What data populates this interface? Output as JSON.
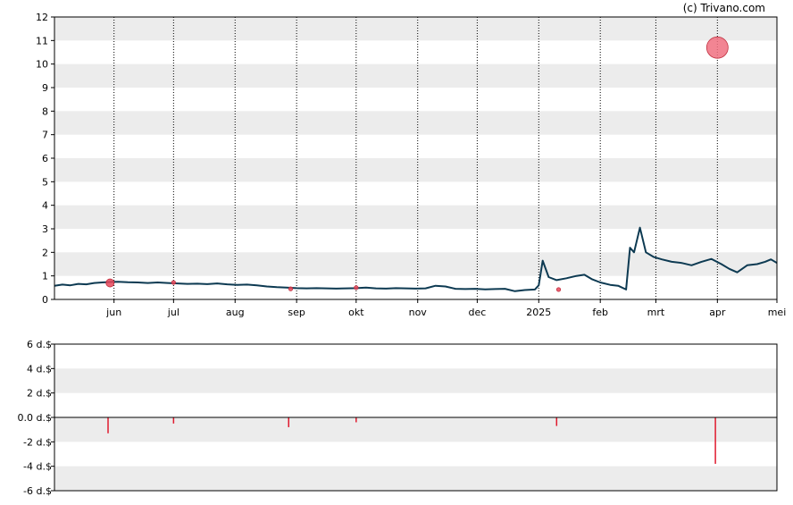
{
  "credit": "(c) Trivano.com",
  "chart_data": [
    {
      "type": "line",
      "panel": "price",
      "ylim": [
        0,
        12
      ],
      "y_ticks": [
        "0",
        "1",
        "2",
        "3",
        "4",
        "5",
        "6",
        "7",
        "8",
        "9",
        "10",
        "11",
        "12"
      ],
      "x_tick_labels": [
        {
          "label": "jun",
          "date": "2024-06-01"
        },
        {
          "label": "jul",
          "date": "2024-07-01"
        },
        {
          "label": "aug",
          "date": "2024-08-01"
        },
        {
          "label": "sep",
          "date": "2024-09-01"
        },
        {
          "label": "okt",
          "date": "2024-10-01"
        },
        {
          "label": "nov",
          "date": "2024-11-01"
        },
        {
          "label": "dec",
          "date": "2024-12-01"
        },
        {
          "label": "2025",
          "date": "2025-01-01"
        },
        {
          "label": "feb",
          "date": "2025-02-01"
        },
        {
          "label": "mrt",
          "date": "2025-03-01"
        },
        {
          "label": "apr",
          "date": "2025-04-01"
        },
        {
          "label": "mei",
          "date": "2025-05-01"
        }
      ],
      "xlim": [
        "2024-05-02",
        "2025-05-01"
      ],
      "grid": "horizontal bands, vertical dotted lines at month starts",
      "series": [
        {
          "color": "#0d3a52",
          "points": [
            [
              "2024-05-02",
              0.58
            ],
            [
              "2024-05-06",
              0.63
            ],
            [
              "2024-05-10",
              0.6
            ],
            [
              "2024-05-14",
              0.66
            ],
            [
              "2024-05-18",
              0.64
            ],
            [
              "2024-05-22",
              0.7
            ],
            [
              "2024-05-26",
              0.72
            ],
            [
              "2024-05-30",
              0.74
            ],
            [
              "2024-06-03",
              0.75
            ],
            [
              "2024-06-08",
              0.73
            ],
            [
              "2024-06-13",
              0.72
            ],
            [
              "2024-06-18",
              0.7
            ],
            [
              "2024-06-23",
              0.72
            ],
            [
              "2024-06-28",
              0.7
            ],
            [
              "2024-07-03",
              0.68
            ],
            [
              "2024-07-08",
              0.66
            ],
            [
              "2024-07-13",
              0.67
            ],
            [
              "2024-07-18",
              0.65
            ],
            [
              "2024-07-23",
              0.68
            ],
            [
              "2024-07-28",
              0.64
            ],
            [
              "2024-08-02",
              0.62
            ],
            [
              "2024-08-07",
              0.63
            ],
            [
              "2024-08-12",
              0.6
            ],
            [
              "2024-08-17",
              0.55
            ],
            [
              "2024-08-22",
              0.52
            ],
            [
              "2024-08-27",
              0.5
            ],
            [
              "2024-09-01",
              0.48
            ],
            [
              "2024-09-06",
              0.47
            ],
            [
              "2024-09-11",
              0.48
            ],
            [
              "2024-09-16",
              0.47
            ],
            [
              "2024-09-21",
              0.46
            ],
            [
              "2024-09-26",
              0.47
            ],
            [
              "2024-10-01",
              0.48
            ],
            [
              "2024-10-06",
              0.5
            ],
            [
              "2024-10-11",
              0.47
            ],
            [
              "2024-10-16",
              0.46
            ],
            [
              "2024-10-21",
              0.48
            ],
            [
              "2024-10-26",
              0.47
            ],
            [
              "2024-10-31",
              0.46
            ],
            [
              "2024-11-05",
              0.47
            ],
            [
              "2024-11-10",
              0.58
            ],
            [
              "2024-11-15",
              0.55
            ],
            [
              "2024-11-20",
              0.45
            ],
            [
              "2024-11-25",
              0.44
            ],
            [
              "2024-11-30",
              0.45
            ],
            [
              "2024-12-05",
              0.43
            ],
            [
              "2024-12-10",
              0.44
            ],
            [
              "2024-12-15",
              0.45
            ],
            [
              "2024-12-20",
              0.35
            ],
            [
              "2024-12-25",
              0.4
            ],
            [
              "2024-12-30",
              0.42
            ],
            [
              "2025-01-01",
              0.6
            ],
            [
              "2025-01-03",
              1.65
            ],
            [
              "2025-01-06",
              0.95
            ],
            [
              "2025-01-10",
              0.82
            ],
            [
              "2025-01-15",
              0.9
            ],
            [
              "2025-01-20",
              1.0
            ],
            [
              "2025-01-24",
              1.05
            ],
            [
              "2025-01-28",
              0.85
            ],
            [
              "2025-02-01",
              0.72
            ],
            [
              "2025-02-06",
              0.62
            ],
            [
              "2025-02-10",
              0.58
            ],
            [
              "2025-02-14",
              0.42
            ],
            [
              "2025-02-16",
              2.2
            ],
            [
              "2025-02-18",
              2.0
            ],
            [
              "2025-02-21",
              3.05
            ],
            [
              "2025-02-24",
              2.0
            ],
            [
              "2025-02-28",
              1.8
            ],
            [
              "2025-03-04",
              1.7
            ],
            [
              "2025-03-09",
              1.6
            ],
            [
              "2025-03-14",
              1.55
            ],
            [
              "2025-03-19",
              1.45
            ],
            [
              "2025-03-24",
              1.6
            ],
            [
              "2025-03-29",
              1.72
            ],
            [
              "2025-04-03",
              1.5
            ],
            [
              "2025-04-07",
              1.3
            ],
            [
              "2025-04-11",
              1.15
            ],
            [
              "2025-04-16",
              1.45
            ],
            [
              "2025-04-21",
              1.5
            ],
            [
              "2025-04-25",
              1.6
            ],
            [
              "2025-04-28",
              1.7
            ],
            [
              "2025-05-01",
              1.55
            ]
          ]
        }
      ],
      "markers": [
        {
          "date": "2024-05-30",
          "y": 0.7,
          "size": "small",
          "color": "#e8475a"
        },
        {
          "date": "2024-07-01",
          "y": 0.72,
          "size": "tiny",
          "color": "#e8475a"
        },
        {
          "date": "2024-08-29",
          "y": 0.45,
          "size": "tiny",
          "color": "#e8475a"
        },
        {
          "date": "2024-10-01",
          "y": 0.5,
          "size": "tiny",
          "color": "#e8475a"
        },
        {
          "date": "2025-01-11",
          "y": 0.42,
          "size": "tiny",
          "color": "#e8475a"
        },
        {
          "date": "2025-04-01",
          "y": 10.7,
          "size": "large",
          "color": "#f07080"
        }
      ]
    },
    {
      "type": "bar",
      "panel": "dividend",
      "ylim": [
        -6,
        6
      ],
      "y_ticks": [
        "6 d.$",
        "4 d.$",
        "2 d.$",
        "0.0 d.$",
        "-2 d.$",
        "-4 d.$",
        "-6 d.$"
      ],
      "y_tick_values": [
        6,
        4,
        2,
        0,
        -2,
        -4,
        -6
      ],
      "grid": "horizontal bands",
      "bar_color": "#e01a2e",
      "bars": [
        {
          "date": "2024-05-29",
          "value": -1.3
        },
        {
          "date": "2024-07-01",
          "value": -0.5
        },
        {
          "date": "2024-08-28",
          "value": -0.8
        },
        {
          "date": "2024-10-01",
          "value": -0.4
        },
        {
          "date": "2025-01-10",
          "value": -0.7
        },
        {
          "date": "2025-03-31",
          "value": -3.8
        }
      ]
    }
  ]
}
